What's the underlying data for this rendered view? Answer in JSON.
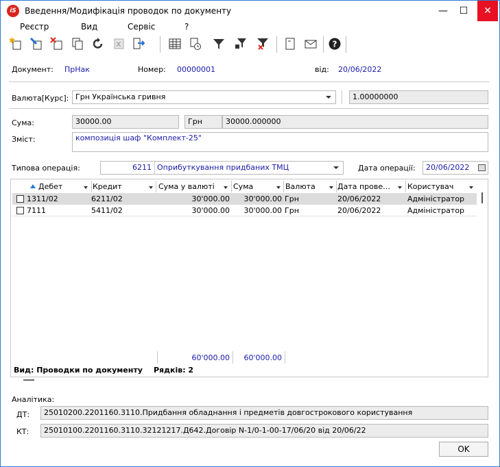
{
  "window": {
    "title": "Введення/Модифікація проводок по документу",
    "app_icon": "iS"
  },
  "menu": [
    "Реєстр",
    "Вид",
    "Сервіс",
    "?"
  ],
  "toolbar_icons": [
    "new-icon",
    "edit-icon",
    "delete-icon",
    "copy-icon",
    "refresh-icon",
    "excel-icon",
    "export-icon",
    "table-icon",
    "history-icon",
    "filter-icon",
    "filter-set-icon",
    "filter-clear-icon",
    "document-icon",
    "mail-icon",
    "help-icon"
  ],
  "header": {
    "document_label": "Документ:",
    "document_value": "ПрНак",
    "number_label": "Номер:",
    "number_value": "00000001",
    "date_label": "від:",
    "date_value": "20/06/2022"
  },
  "currency": {
    "label": "Валюта[Курс]:",
    "value": "Грн Українська гривня",
    "rate": "1.00000000"
  },
  "sum": {
    "label": "Сума:",
    "value": "30000.00",
    "currency": "Грн",
    "converted": "30000.000000"
  },
  "content": {
    "label": "Зміст:",
    "value": "композиція шаф \"Комплект-25\""
  },
  "operation": {
    "label": "Типова операція:",
    "code": "6211",
    "name": "Оприбуткування придбаних ТМЦ",
    "date_label": "Дата операції:",
    "date_value": "20/06/2022"
  },
  "grid": {
    "columns": [
      "Дебет",
      "Кредит",
      "Сума у валюті",
      "Сума",
      "Валюта",
      "Дата прове…",
      "Користувач"
    ],
    "rows": [
      [
        "1311/02",
        "6211/02",
        "30'000.00",
        "30'000.00",
        "Грн",
        "20/06/2022",
        "Адміністратор"
      ],
      [
        "7111",
        "5411/02",
        "30'000.00",
        "30'000.00",
        "Грн",
        "20/06/2022",
        "Адміністратор"
      ]
    ],
    "totals": {
      "sum_currency": "60'000.00",
      "sum": "60'000.00"
    },
    "footer_view": "Вид: Проводки по документу",
    "footer_rows": "Рядків: 2"
  },
  "analytics": {
    "label": "Аналітика:",
    "dt_label": "ДТ:",
    "dt_value": "25010200.2201160.3110.Придбання обладнання і предметів довгострокового користування",
    "kt_label": "КТ:",
    "kt_value": "25010100.2201160.3110.32121217.Д642.Договір N-1/0-1-00-17/06/20 від 20/06/22"
  },
  "ok_label": "OK"
}
